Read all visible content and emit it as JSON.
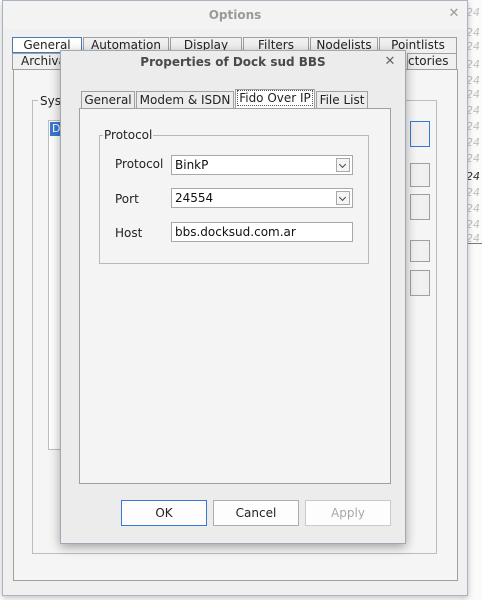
{
  "options": {
    "title": "Options",
    "tabs_row1": [
      "General",
      "Automation",
      "Display",
      "Filters",
      "Nodelists",
      "Pointlists"
    ],
    "tabs_row2": [
      "Archiva",
      "ctories"
    ],
    "group_label": "Syst",
    "list_selected": "Do"
  },
  "background": {
    "numbers": [
      "24",
      "24",
      "24",
      "24",
      "24",
      "24",
      "24",
      "24",
      "24",
      "24",
      "24",
      "24",
      "24",
      "24",
      "24",
      "24"
    ]
  },
  "dialog": {
    "title": "Properties of Dock sud BBS",
    "tabs": [
      "General",
      "Modem & ISDN",
      "Fido Over IP",
      "File List"
    ],
    "selected_tab": "Fido Over IP",
    "protocol_group": {
      "label": "Protocol",
      "fields": {
        "protocol": {
          "label": "Protocol",
          "value": "BinkP"
        },
        "port": {
          "label": "Port",
          "value": "24554"
        },
        "host": {
          "label": "Host",
          "value": "bbs.docksud.com.ar"
        }
      }
    },
    "buttons": {
      "ok": "OK",
      "cancel": "Cancel",
      "apply": "Apply"
    }
  }
}
